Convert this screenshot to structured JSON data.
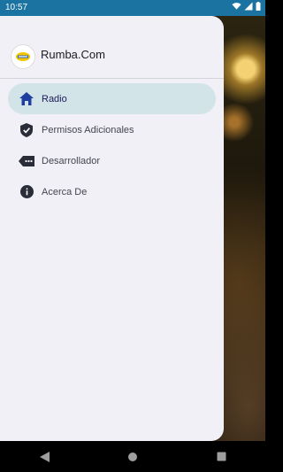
{
  "status_bar": {
    "time": "10:57",
    "icons": [
      "wifi-icon",
      "signal-icon",
      "battery-icon"
    ]
  },
  "drawer": {
    "app_title": "Rumba.Com",
    "logo_icon": "app-logo-icon",
    "items": [
      {
        "label": "Radio",
        "icon": "home-icon",
        "active": true
      },
      {
        "label": "Permisos Adicionales",
        "icon": "shield-check-icon",
        "active": false
      },
      {
        "label": "Desarrollador",
        "icon": "code-dots-icon",
        "active": false
      },
      {
        "label": "Acerca De",
        "icon": "info-icon",
        "active": false
      }
    ]
  },
  "nav_bar": {
    "buttons": [
      "back-icon",
      "home-circle-icon",
      "recents-icon"
    ]
  },
  "colors": {
    "status_bar": "#1a73a0",
    "drawer_bg": "#f1f0f6",
    "active_item": "#d3e4e8",
    "active_icon": "#1e3fa0"
  }
}
